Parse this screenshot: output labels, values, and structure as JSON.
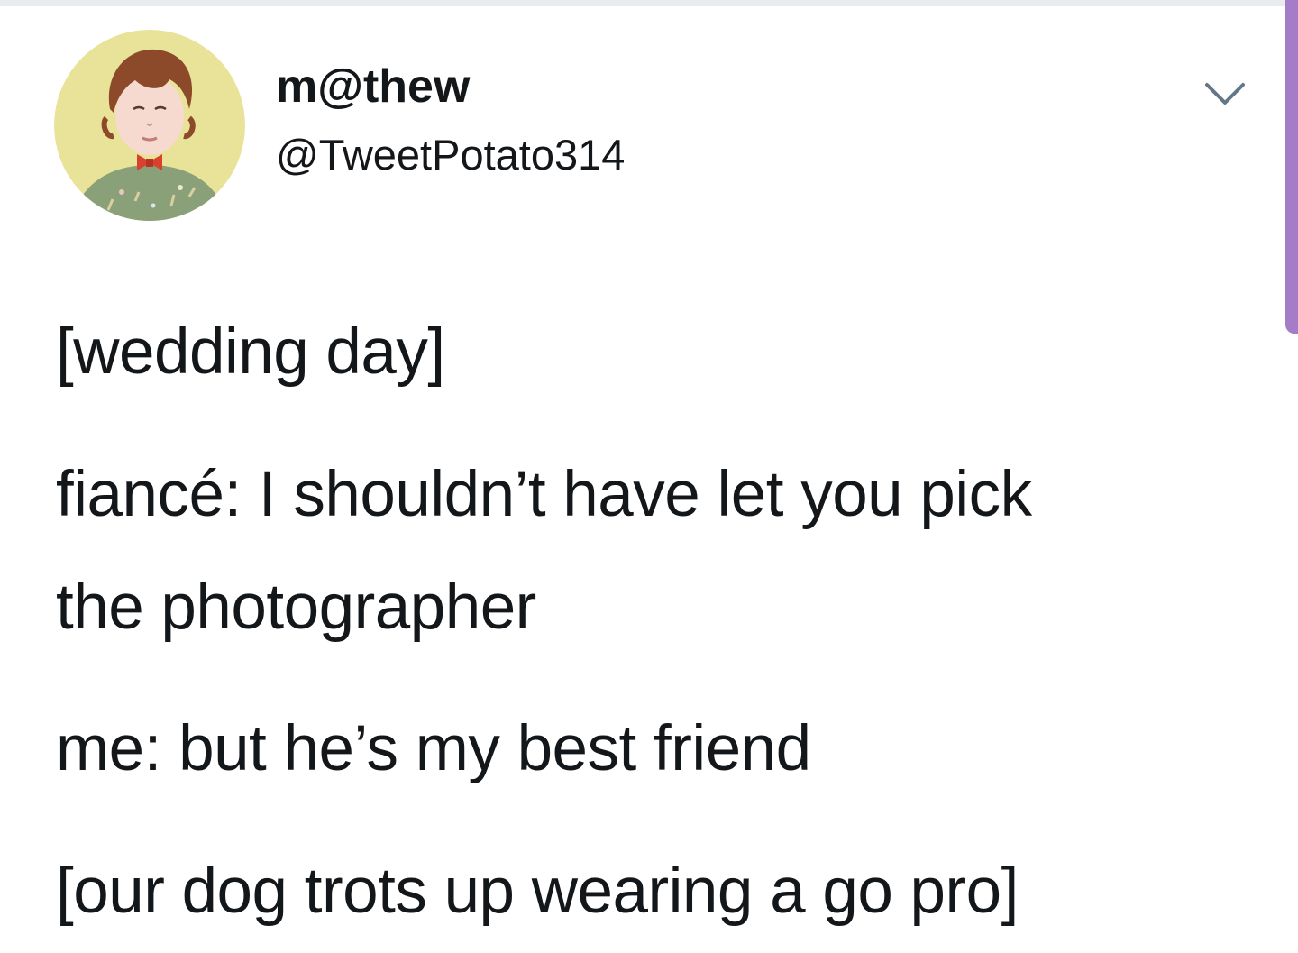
{
  "tweet": {
    "display_name": "m@thew",
    "handle": "@TweetPotato314",
    "avatar_icon": "cartoon-child-avatar",
    "menu_icon": "chevron-down-icon",
    "lines": [
      "[wedding day]",
      "fiancé: I shouldn’t have let you pick",
      "the photographer",
      "me: but he’s my best friend",
      "[our dog trots up wearing a go pro]"
    ]
  },
  "colors": {
    "text": "#14171a",
    "divider": "#e6ecf0",
    "scroll_accent": "#a57cc8",
    "chevron": "#657786"
  }
}
